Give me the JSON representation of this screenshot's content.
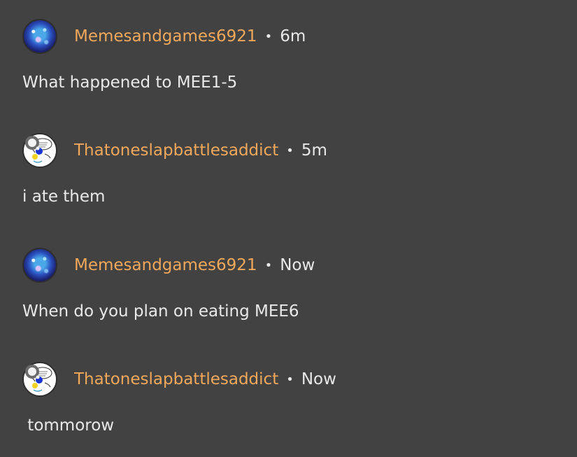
{
  "messages": [
    {
      "author": "Memesandgames6921",
      "separator": "•",
      "time": "6m",
      "text": "What happened to MEE1-5",
      "avatar_icon": "galaxy-avatar-icon"
    },
    {
      "author": "Thatoneslapbattlesaddict",
      "separator": "•",
      "time": "5m",
      "text": "i ate them",
      "avatar_icon": "drawing-avatar-icon"
    },
    {
      "author": "Memesandgames6921",
      "separator": "•",
      "time": "Now",
      "text": "When do you plan on eating MEE6",
      "avatar_icon": "galaxy-avatar-icon"
    },
    {
      "author": "Thatoneslapbattlesaddict",
      "separator": "•",
      "time": "Now",
      "text": " tommorow",
      "avatar_icon": "drawing-avatar-icon"
    }
  ],
  "colors": {
    "background": "#424242",
    "username": "#f1a85a",
    "text": "#e9e9e9"
  }
}
